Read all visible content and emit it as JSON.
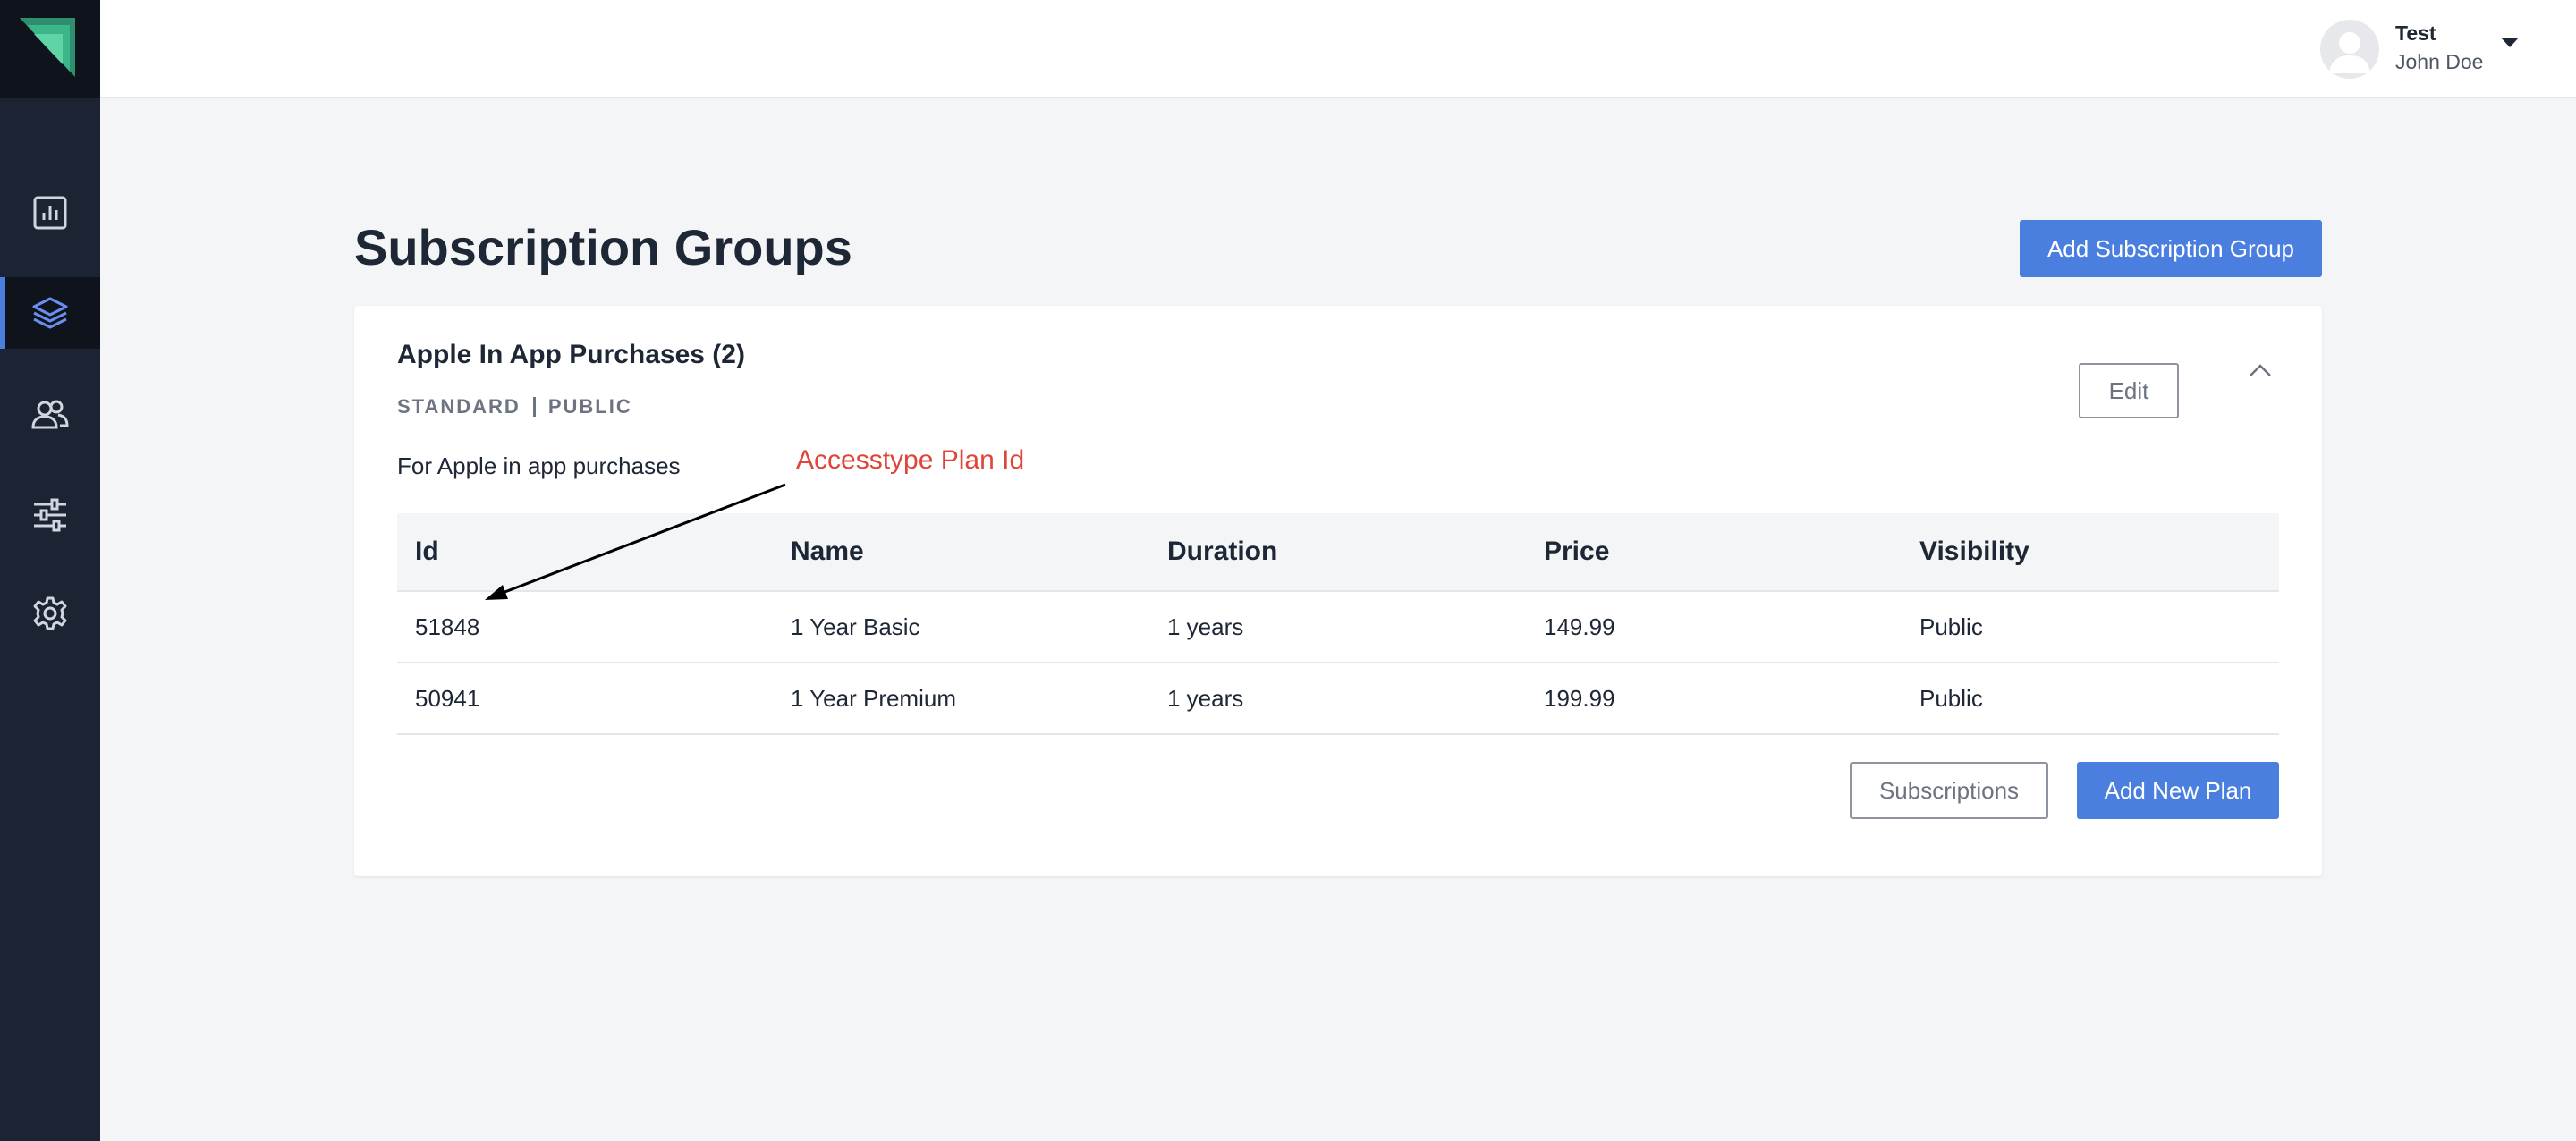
{
  "header": {
    "user_name": "Test",
    "user_sub": "John Doe"
  },
  "sidebar": {
    "items": [
      {
        "icon": "chart-icon",
        "active": false
      },
      {
        "icon": "layers-icon",
        "active": true
      },
      {
        "icon": "users-icon",
        "active": false
      },
      {
        "icon": "sliders-icon",
        "active": false
      },
      {
        "icon": "gear-icon",
        "active": false
      }
    ]
  },
  "main": {
    "title": "Subscription Groups",
    "add_group_label": "Add Subscription Group"
  },
  "group": {
    "title": "Apple In App Purchases (2)",
    "tag_type": "STANDARD",
    "tag_visibility": "PUBLIC",
    "description": "For Apple in app purchases",
    "edit_label": "Edit",
    "columns": [
      "Id",
      "Name",
      "Duration",
      "Price",
      "Visibility"
    ],
    "rows": [
      [
        "51848",
        "1 Year Basic",
        "1 years",
        "149.99",
        "Public"
      ],
      [
        "50941",
        "1 Year Premium",
        "1 years",
        "199.99",
        "Public"
      ]
    ],
    "subscriptions_label": "Subscriptions",
    "add_plan_label": "Add New Plan"
  },
  "annotation": {
    "text": "Accesstype Plan Id"
  },
  "colors": {
    "accent": "#4a7fe0",
    "sidebar_bg": "#1c2433",
    "annotation": "#e0453a",
    "logo": "#3bb58a"
  }
}
